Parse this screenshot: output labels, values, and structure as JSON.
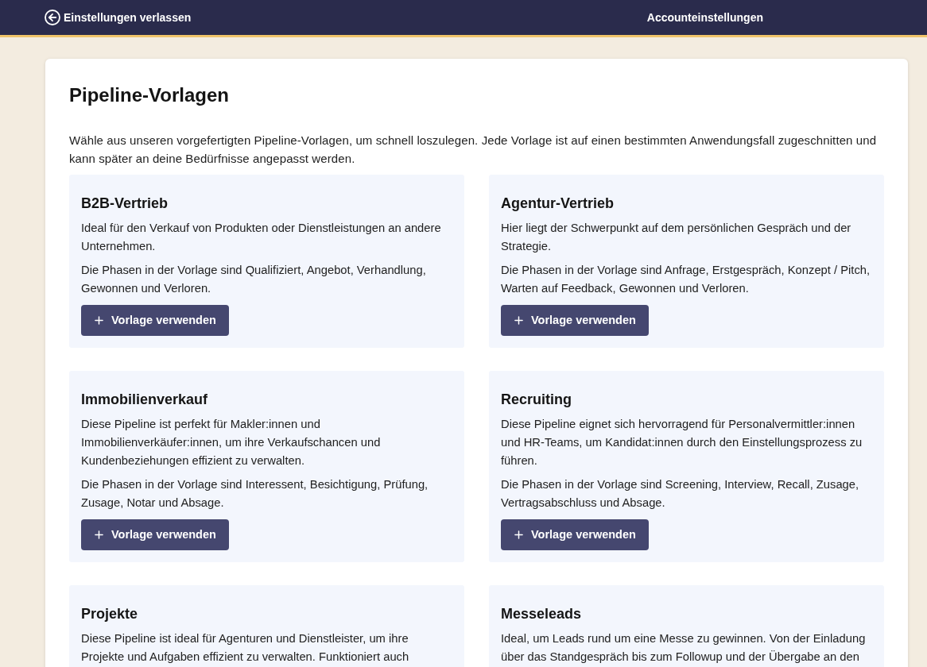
{
  "header": {
    "back_link": "Einstellungen verlassen",
    "title": "Accounteinstellungen"
  },
  "page": {
    "title": "Pipeline-Vorlagen",
    "intro": "Wähle aus unseren vorgefertigten Pipeline-Vorlagen, um schnell loszulegen. Jede Vorlage ist auf einen bestimmten Anwendungsfall zugeschnitten und kann später an deine Bedürfnisse angepasst werden."
  },
  "templates": [
    {
      "title": "B2B-Vertrieb",
      "description": "Ideal für den Verkauf von Produkten oder Dienstleistungen an andere Unternehmen.",
      "phases": "Die Phasen in der Vorlage sind Qualifiziert, Angebot, Verhandlung, Gewonnen und Verloren.",
      "button": "Vorlage verwenden"
    },
    {
      "title": "Agentur-Vertrieb",
      "description": "Hier liegt der Schwerpunkt auf dem persönlichen Gespräch und der Strategie.",
      "phases": "Die Phasen in der Vorlage sind Anfrage, Erstgespräch, Konzept / Pitch, Warten auf Feedback, Gewonnen und Verloren.",
      "button": "Vorlage verwenden"
    },
    {
      "title": "Immobilienverkauf",
      "description": "Diese Pipeline ist perfekt für Makler:innen und Immobilienverkäufer:innen, um ihre Verkaufschancen und Kundenbeziehungen effizient zu verwalten.",
      "phases": "Die Phasen in der Vorlage sind Interessent, Besichtigung, Prüfung, Zusage, Notar und Absage.",
      "button": "Vorlage verwenden"
    },
    {
      "title": "Recruiting",
      "description": "Diese Pipeline eignet sich hervorragend für Personalvermittler:innen und HR-Teams, um Kandidat:innen durch den Einstellungsprozess zu führen.",
      "phases": "Die Phasen in der Vorlage sind Screening, Interview, Recall, Zusage, Vertragsabschluss und Absage.",
      "button": "Vorlage verwenden"
    },
    {
      "title": "Projekte",
      "description": "Diese Pipeline ist ideal für Agenturen und Dienstleister, um ihre Projekte und Aufgaben effizient zu verwalten. Funktioniert auch"
    },
    {
      "title": "Messeleads",
      "description": "Ideal, um Leads rund um eine Messe zu gewinnen. Von der Einladung über das Standgespräch bis zum Followup und der Übergabe an den"
    }
  ]
}
